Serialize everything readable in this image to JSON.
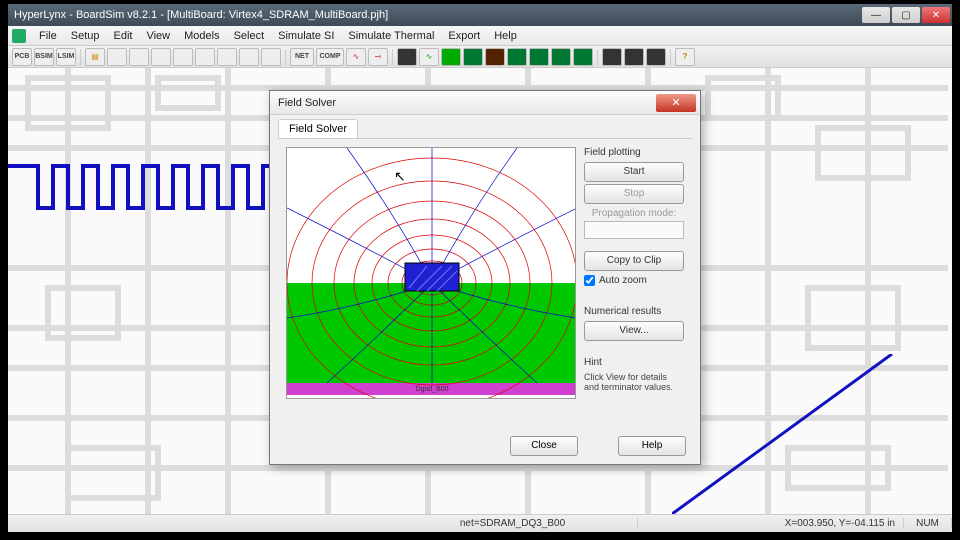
{
  "app": {
    "title": "HyperLynx - BoardSim v8.2.1 - [MultiBoard: Virtex4_SDRAM_MultiBoard.pjh]"
  },
  "menu": {
    "file": "File",
    "setup": "Setup",
    "edit": "Edit",
    "view": "View",
    "models": "Models",
    "select": "Select",
    "simSI": "Simulate SI",
    "simThermal": "Simulate Thermal",
    "export": "Export",
    "help": "Help"
  },
  "toolbar": {
    "pcb": "PCB",
    "bsim": "BSIM",
    "lsim": "LSIM",
    "net": "NET",
    "comp": "COMP"
  },
  "status": {
    "net": "net=SDRAM_DQ3_B00",
    "coord": "X=003.950, Y=-04.115 in",
    "num": "NUM"
  },
  "dialog": {
    "title": "Field Solver",
    "tab": "Field Solver",
    "fieldPlotting": "Field plotting",
    "start": "Start",
    "stop": "Stop",
    "propMode": "Propagation mode:",
    "copy": "Copy to Clip",
    "autozoom": "Auto zoom",
    "numResults": "Numerical results",
    "view": "View...",
    "hintLabel": "Hint",
    "hint": "Click View for details and terminator values.",
    "close": "Close",
    "help": "Help",
    "traceLabel": "Dgnd_B00"
  }
}
